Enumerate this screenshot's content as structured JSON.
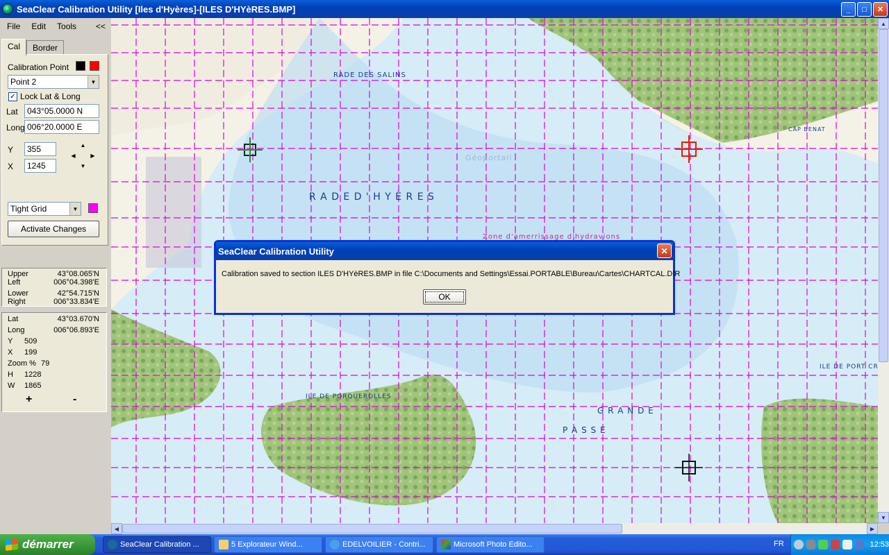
{
  "window": {
    "title": "SeaClear Calibration Utility [Iles d'Hyères]-[ILES D'HYèRES.BMP]",
    "controls": {
      "minimize": "_",
      "maximize": "□",
      "close": "✕"
    }
  },
  "menu": {
    "items": [
      "File",
      "Edit",
      "Tools"
    ],
    "collapse_label": "<<"
  },
  "tabs": [
    "Cal",
    "Border"
  ],
  "cal": {
    "calibration_point_label": "Calibration Point",
    "swatch_colors": [
      "#000000",
      "#ff0000"
    ],
    "point_select": "Point 2",
    "lock_label": "Lock Lat & Long",
    "lock_checked": "✓",
    "lat_label": "Lat",
    "lat_value": "043°05.0000 N",
    "long_label": "Long",
    "long_value": "006°20.0000 E",
    "y_label": "Y",
    "y_value": "355",
    "x_label": "X",
    "x_value": "1245",
    "grid_select": "Tight Grid",
    "grid_color": "#ff00ff",
    "activate_button": "Activate Changes"
  },
  "bounds": {
    "upper_label": "Upper",
    "upper_value": "43°08.065'N",
    "left_label": "Left",
    "left_value": "006°04.398'E",
    "lower_label": "Lower",
    "lower_value": "42°54.715'N",
    "right_label": "Right",
    "right_value": "006°33.834'E"
  },
  "cursor": {
    "lat_label": "Lat",
    "lat_value": "43°03.670'N",
    "long_label": "Long",
    "long_value": "006°06.893'E",
    "y_label": "Y",
    "y_value": "509",
    "x_label": "X",
    "x_value": "199",
    "zoom_label": "Zoom %",
    "zoom_value": "79",
    "h_label": "H",
    "h_value": "1228",
    "w_label": "W",
    "w_value": "1865",
    "zoom_in": "+",
    "zoom_out": "-"
  },
  "map": {
    "labels": [
      "RADE DES SALINS",
      "R A D E   D '   H Y È R E S",
      "CAP BENAT",
      "ILE DE PORQUEROLLES",
      "G R A N D E",
      "P A S S E",
      "ILE DE PORT CROS",
      "Zone d'amerrissage d'hydravions",
      "Géoportail"
    ],
    "grid_color": "#e000e0"
  },
  "dialog": {
    "title": "SeaClear Calibration Utility",
    "message": "Calibration saved to section ILES D'HYèRES.BMP in file C:\\Documents and Settings\\Essai.PORTABLE\\Bureau\\Cartes\\CHARTCAL.DIR",
    "ok_label": "OK",
    "close": "✕"
  },
  "taskbar": {
    "start_label": "démarrer",
    "tasks": [
      "SeaClear Calibration ...",
      "5 Explorateur Wind...",
      "EDELVOILIER - Contri...",
      "Microsoft Photo Edito..."
    ],
    "lang": "FR",
    "clock": "12:53"
  }
}
